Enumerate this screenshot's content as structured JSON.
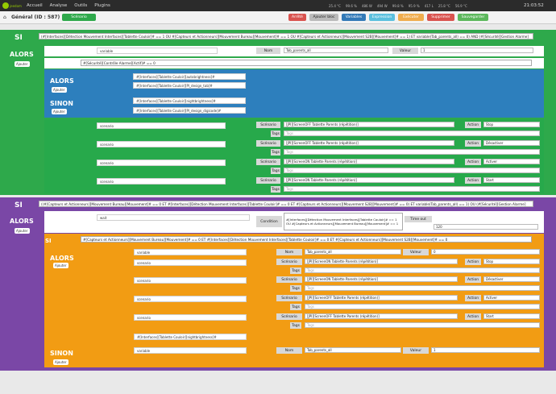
{
  "topbar": {
    "logo": "jeedom",
    "nav": [
      "Accueil",
      "Analyse",
      "Outils",
      "Plugins"
    ],
    "stats": [
      "25.4 °C",
      "99.6 %",
      "486 W",
      "494 W",
      "99.8 %",
      "95.9 %",
      "417 L",
      "25.8 °C",
      "56.9 °C"
    ],
    "clock": "21:03:52"
  },
  "toolbar": {
    "title": "Général (ID : 587)",
    "tab": "Scénario",
    "buttons": [
      "Arrêté",
      "Ajouter bloc",
      "Variables",
      "Expression",
      "Exécuter",
      "Supprimer",
      "Sauvegarder"
    ]
  },
  "labels": {
    "si": "SI",
    "alors": "ALORS",
    "sinon": "SINON",
    "ajouter": "Ajouter",
    "variable": "variable",
    "nom": "Nom",
    "valeur": "Valeur",
    "scenario": "scenario",
    "scenario_lbl": "Scénario",
    "action": "Action",
    "tags": "Tags",
    "tags_ph": "Tags",
    "wait": "wait",
    "condition": "Condition",
    "timeout": "Time out"
  },
  "block1": {
    "condition": "(#[Interfaces][Détection Mouvement Interfaces][Tablette Couloir]# == 1 OU #[Capteurs et Actionneurs][Mouvement Bureau][Mouvement]# == 1 OU #[Capteurs et Actionneurs][Mouvement S2B][Mouvement]# == 1) ET variable(Tab_parents_all) == 0) AND (#[Sécurité][Gestion Alarme]",
    "var_name": "Tab_parents_all",
    "var_value": "1",
    "inner_condition": "#[Sécurité][Contrôle Alarme][Actif]# == 0",
    "alors_cmds": [
      "#[Interfaces][Tablette Couloir][autobrightness]#",
      "#[Interfaces][Tablette Couloir][PI_design_tab]#"
    ],
    "sinon_cmds": [
      "#[Interfaces][Tablette Couloir][nightbrightness]#",
      "#[Interfaces][Tablette Couloir][PI_design_digicode]#"
    ],
    "scenarios": [
      {
        "name": "[JPI][ScreenOFF Tablette Parents (répétition)]",
        "action": "Stop"
      },
      {
        "name": "[JPI][ScreenOFF Tablette Parents (répétition)]",
        "action": "Désactiver"
      },
      {
        "name": "[JPI][ScreenON Tablette Parents (répétition)]",
        "action": "Activer"
      },
      {
        "name": "[JPI][ScreenON Tablette Parents (répétition)]",
        "action": "Start"
      }
    ]
  },
  "block2": {
    "condition": "((#[Capteurs et Actionneurs][Mouvement Bureau][Mouvement]# == 0 ET #[Interfaces][Détection Mouvement Interfaces][Tablette Couloir]# == 0 ET #[Capteurs et Actionneurs][Mouvement S2B][Mouvement]# == 0) ET variable(Tab_parents_all) == 1) OU (#[Sécurité][Gestion Alarme]",
    "wait_condition": "#[Interfaces][Détection Mouvement Interfaces][Tablette Couloir]# == 1 OU #[Capteurs et Actionneurs][Mouvement Bureau][Mouvement]# == 1",
    "timeout": "120",
    "inner_condition": "#[Capteurs et Actionneurs][Mouvement Bureau][Mouvement]# == 0 ET #[Interfaces][Détection Mouvement Interfaces][Tablette Couloir]# == 0 ET #[Capteurs et Actionneurs][Mouvement S2B][Mouvement]# == 0",
    "var_name": "Tab_parents_all",
    "var_value": "0",
    "scenarios": [
      {
        "name": "[JPI][ScreenON Tablette Parents (répétition)]",
        "action": "Stop"
      },
      {
        "name": "[JPI][ScreenON Tablette Parents (répétition)]",
        "action": "Désactiver"
      },
      {
        "name": "[JPI][ScreenOFF Tablette Parents (répétition)]",
        "action": "Activer"
      },
      {
        "name": "[JPI][ScreenOFF Tablette Parents (répétition)]",
        "action": "Start"
      }
    ],
    "cmd": "#[Interfaces][Tablette Couloir][nightbrightness]#",
    "sinon_var_name": "Tab_parents_all",
    "sinon_var_value": "1"
  },
  "colors": {
    "green": "#2ea94b",
    "purple": "#7a47a6",
    "blue": "#2d7fbd",
    "orange": "#f29c13",
    "topbar": "#2b2b2b"
  }
}
